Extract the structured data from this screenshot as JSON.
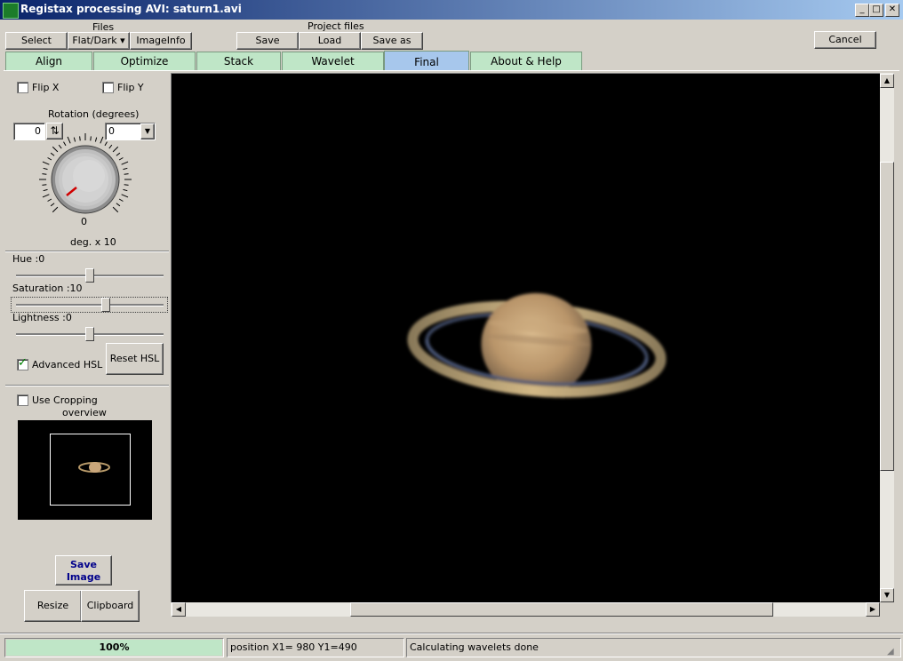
{
  "window": {
    "title": "Registax processing AVI: saturn1.avi",
    "minimize": "_",
    "maximize": "□",
    "close": "✕"
  },
  "toolbar": {
    "files_label": "Files",
    "select": "Select",
    "flatdark": "Flat/Dark ▾",
    "imageinfo": "ImageInfo",
    "project_label": "Project files",
    "save": "Save",
    "load": "Load",
    "saveas": "Save as",
    "cancel": "Cancel"
  },
  "tabs": [
    "Align",
    "Optimize",
    "Stack",
    "Wavelet",
    "Final",
    "About & Help"
  ],
  "active_tab": "Final",
  "panel": {
    "flip_x": "Flip X",
    "flip_y": "Flip Y",
    "rotation_label": "Rotation (degrees)",
    "rotation_value": "0",
    "rotation_select": "0",
    "dial_value": "0",
    "dial_caption": "deg. x 10",
    "hue_label": "Hue :0",
    "saturation_label": "Saturation :10",
    "lightness_label": "Lightness :0",
    "advanced_hsl": "Advanced HSL",
    "advanced_hsl_checked": true,
    "reset_hsl": "Reset HSL",
    "use_cropping": "Use Cropping",
    "overview": "overview",
    "save_image": "Save Image",
    "resize": "Resize",
    "clipboard": "Clipboard",
    "hue_value": 0,
    "saturation_value": 10,
    "lightness_value": 0
  },
  "status": {
    "progress": "100%",
    "progress_fraction": 1.0,
    "position": "position X1= 980 Y1=490",
    "message": "Calculating wavelets done"
  },
  "colors": {
    "title_start": "#0a246a",
    "title_end": "#a6caf0",
    "tab_inactive": "#bfe6c7",
    "tab_active": "#a7c7ec",
    "progress_fill": "#bfe6c7",
    "save_image_text": "#00008b"
  }
}
